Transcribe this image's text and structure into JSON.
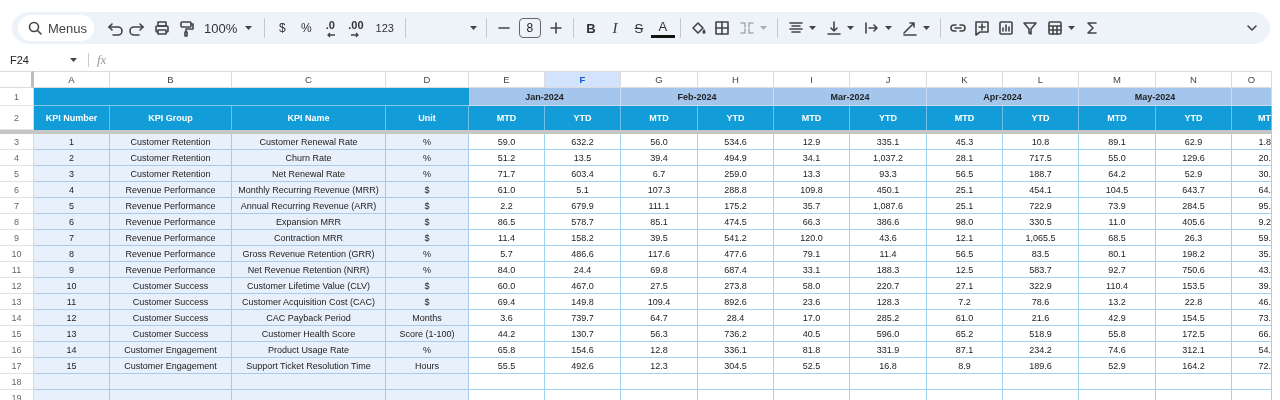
{
  "toolbar": {
    "search": {
      "placeholder": "Menus"
    },
    "items": [
      {
        "kind": "undo",
        "disabled": false
      },
      {
        "kind": "redo",
        "disabled": false
      },
      {
        "kind": "print",
        "disabled": false
      },
      {
        "kind": "paint_format",
        "disabled": false
      },
      {
        "kind": "zoom",
        "text": "100%",
        "disabled": false
      },
      {
        "kind": "divider"
      },
      {
        "kind": "currency",
        "text": "$",
        "disabled": false
      },
      {
        "kind": "percent",
        "text": "%",
        "disabled": false
      },
      {
        "kind": "decimal_less",
        "text": ".0",
        "disabled": false
      },
      {
        "kind": "decimal_more",
        "text": ".00",
        "disabled": false
      },
      {
        "kind": "number_format",
        "text": "123",
        "disabled": false
      },
      {
        "kind": "divider"
      },
      {
        "kind": "font",
        "disabled": false
      },
      {
        "kind": "divider"
      },
      {
        "kind": "minus",
        "disabled": false
      },
      {
        "kind": "font_size",
        "text": "8",
        "disabled": false
      },
      {
        "kind": "plus",
        "disabled": false
      },
      {
        "kind": "divider"
      },
      {
        "kind": "bold",
        "text": "B",
        "disabled": false
      },
      {
        "kind": "italic",
        "text": "I",
        "disabled": false
      },
      {
        "kind": "strikethrough",
        "text": "S",
        "disabled": false
      },
      {
        "kind": "text_color",
        "text": "A",
        "disabled": false
      },
      {
        "kind": "divider"
      },
      {
        "kind": "fill_color",
        "disabled": false
      },
      {
        "kind": "borders",
        "disabled": false
      },
      {
        "kind": "merge",
        "disabled": true
      },
      {
        "kind": "divider"
      },
      {
        "kind": "align",
        "disabled": false
      },
      {
        "kind": "valign",
        "disabled": false
      },
      {
        "kind": "wrap",
        "disabled": false
      },
      {
        "kind": "rotate",
        "disabled": false
      },
      {
        "kind": "divider"
      },
      {
        "kind": "link",
        "disabled": false
      },
      {
        "kind": "comment",
        "disabled": false
      },
      {
        "kind": "chart",
        "disabled": false
      },
      {
        "kind": "filter",
        "disabled": false
      },
      {
        "kind": "functions_table",
        "disabled": false
      },
      {
        "kind": "sum",
        "disabled": false
      }
    ]
  },
  "formula_bar": {
    "cell_ref": "F24",
    "fx": "fx"
  },
  "column_headers": [
    {
      "label": "A",
      "selected": false
    },
    {
      "label": "B",
      "selected": false
    },
    {
      "label": "C",
      "selected": false
    },
    {
      "label": "D",
      "selected": false
    },
    {
      "label": "E",
      "selected": false
    },
    {
      "label": "F",
      "selected": true
    },
    {
      "label": "G",
      "selected": false
    },
    {
      "label": "H",
      "selected": false
    },
    {
      "label": "I",
      "selected": false
    },
    {
      "label": "J",
      "selected": false
    },
    {
      "label": "K",
      "selected": false
    },
    {
      "label": "L",
      "selected": false
    },
    {
      "label": "M",
      "selected": false
    },
    {
      "label": "N",
      "selected": false
    },
    {
      "label": "O",
      "selected": false
    }
  ],
  "row_numbers": [
    "1",
    "2",
    "3",
    "4",
    "5",
    "6",
    "7",
    "8",
    "9",
    "10",
    "11",
    "12",
    "13",
    "14",
    "15",
    "16",
    "17",
    "18",
    "19"
  ],
  "months": [
    "Jan-2024",
    "Feb-2024",
    "Mar-2024",
    "Apr-2024",
    "May-2024"
  ],
  "table_headers": [
    "KPI Number",
    "KPI Group",
    "KPI Name",
    "Unit",
    "MTD",
    "YTD",
    "MTD",
    "YTD",
    "MTD",
    "YTD",
    "MTD",
    "YTD",
    "MTD",
    "YTD",
    "MT"
  ],
  "rows": [
    {
      "kpi_number": "1",
      "kpi_group": "Customer Retention",
      "kpi_name": "Customer Renewal Rate",
      "unit": "%",
      "values": [
        "59.0",
        "632.2",
        "56.0",
        "534.6",
        "12.9",
        "335.1",
        "45.3",
        "10.8",
        "89.1",
        "62.9",
        "1.8"
      ]
    },
    {
      "kpi_number": "2",
      "kpi_group": "Customer Retention",
      "kpi_name": "Churn Rate",
      "unit": "%",
      "values": [
        "51.2",
        "13.5",
        "39.4",
        "494.9",
        "34.1",
        "1,037.2",
        "28.1",
        "717.5",
        "55.0",
        "129.6",
        "20."
      ]
    },
    {
      "kpi_number": "3",
      "kpi_group": "Customer Retention",
      "kpi_name": "Net Renewal Rate",
      "unit": "%",
      "values": [
        "71.7",
        "603.4",
        "6.7",
        "259.0",
        "13.3",
        "93.3",
        "56.5",
        "188.7",
        "64.2",
        "52.9",
        "30."
      ]
    },
    {
      "kpi_number": "4",
      "kpi_group": "Revenue Performance",
      "kpi_name": "Monthly Recurring Revenue (MRR)",
      "unit": "$",
      "values": [
        "61.0",
        "5.1",
        "107.3",
        "288.8",
        "109.8",
        "450.1",
        "25.1",
        "454.1",
        "104.5",
        "643.7",
        "64."
      ]
    },
    {
      "kpi_number": "5",
      "kpi_group": "Revenue Performance",
      "kpi_name": "Annual Recurring Revenue (ARR)",
      "unit": "$",
      "values": [
        "2.2",
        "679.9",
        "111.1",
        "175.2",
        "35.7",
        "1,087.6",
        "25.1",
        "722.9",
        "73.9",
        "284.5",
        "95."
      ]
    },
    {
      "kpi_number": "6",
      "kpi_group": "Revenue Performance",
      "kpi_name": "Expansion MRR",
      "unit": "$",
      "values": [
        "86.5",
        "578.7",
        "85.1",
        "474.5",
        "66.3",
        "386.6",
        "98.0",
        "330.5",
        "11.0",
        "405.6",
        "9.2"
      ]
    },
    {
      "kpi_number": "7",
      "kpi_group": "Revenue Performance",
      "kpi_name": "Contraction MRR",
      "unit": "$",
      "values": [
        "11.4",
        "158.2",
        "39.5",
        "541.2",
        "120.0",
        "43.6",
        "12.1",
        "1,065.5",
        "68.5",
        "26.3",
        "59."
      ]
    },
    {
      "kpi_number": "8",
      "kpi_group": "Revenue Performance",
      "kpi_name": "Gross Revenue Retention (GRR)",
      "unit": "%",
      "values": [
        "5.7",
        "486.6",
        "117.6",
        "477.6",
        "79.1",
        "11.4",
        "56.5",
        "83.5",
        "80.1",
        "198.2",
        "35."
      ]
    },
    {
      "kpi_number": "9",
      "kpi_group": "Revenue Performance",
      "kpi_name": "Net Revenue Retention (NRR)",
      "unit": "%",
      "values": [
        "84.0",
        "24.4",
        "69.8",
        "687.4",
        "33.1",
        "188.3",
        "12.5",
        "583.7",
        "92.7",
        "750.6",
        "43."
      ]
    },
    {
      "kpi_number": "10",
      "kpi_group": "Customer Success",
      "kpi_name": "Customer Lifetime Value (CLV)",
      "unit": "$",
      "values": [
        "60.0",
        "467.0",
        "27.5",
        "273.8",
        "58.0",
        "220.7",
        "27.1",
        "322.9",
        "110.4",
        "153.5",
        "39."
      ]
    },
    {
      "kpi_number": "11",
      "kpi_group": "Customer Success",
      "kpi_name": "Customer Acquisition Cost (CAC)",
      "unit": "$",
      "values": [
        "69.4",
        "149.8",
        "109.4",
        "892.6",
        "23.6",
        "128.3",
        "7.2",
        "78.6",
        "13.2",
        "22.8",
        "46."
      ]
    },
    {
      "kpi_number": "12",
      "kpi_group": "Customer Success",
      "kpi_name": "CAC Payback Period",
      "unit": "Months",
      "values": [
        "3.6",
        "739.7",
        "64.7",
        "28.4",
        "17.0",
        "285.2",
        "61.0",
        "21.6",
        "42.9",
        "154.5",
        "73."
      ]
    },
    {
      "kpi_number": "13",
      "kpi_group": "Customer Success",
      "kpi_name": "Customer Health Score",
      "unit": "Score (1-100)",
      "values": [
        "44.2",
        "130.7",
        "56.3",
        "736.2",
        "40.5",
        "596.0",
        "65.2",
        "518.9",
        "55.8",
        "172.5",
        "66."
      ]
    },
    {
      "kpi_number": "14",
      "kpi_group": "Customer Engagement",
      "kpi_name": "Product Usage Rate",
      "unit": "%",
      "values": [
        "65.8",
        "154.6",
        "12.8",
        "336.1",
        "81.8",
        "331.9",
        "87.1",
        "234.2",
        "74.6",
        "312.1",
        "54."
      ]
    },
    {
      "kpi_number": "15",
      "kpi_group": "Customer Engagement",
      "kpi_name": "Support Ticket Resolution Time",
      "unit": "Hours",
      "values": [
        "55.5",
        "492.6",
        "12.3",
        "304.5",
        "52.5",
        "16.8",
        "8.9",
        "189.6",
        "52.9",
        "164.2",
        "72."
      ]
    }
  ]
}
